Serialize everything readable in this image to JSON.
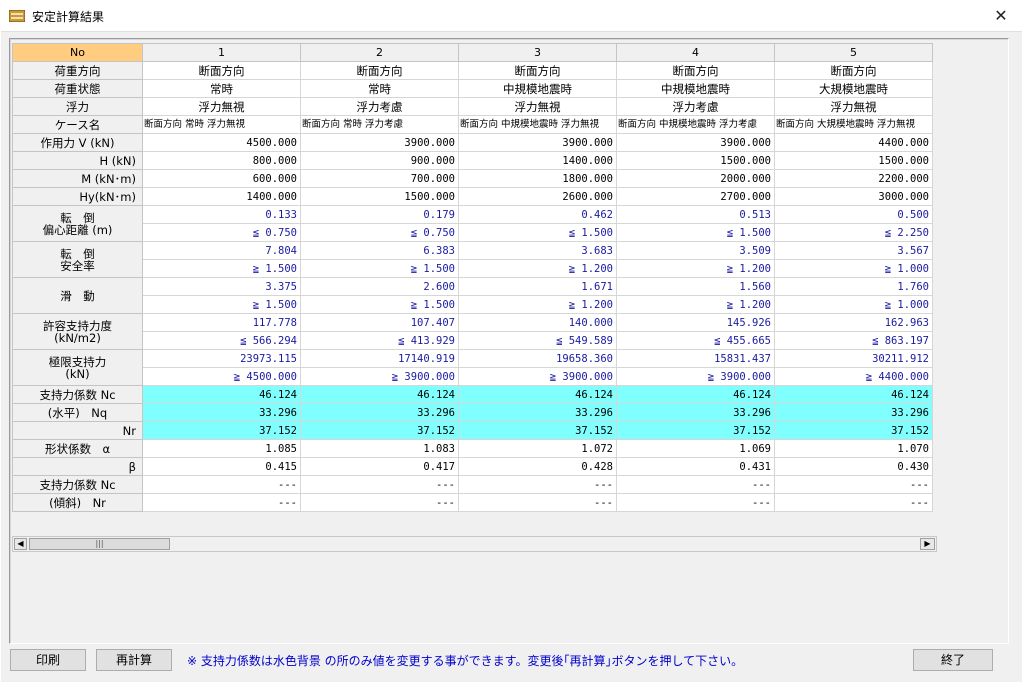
{
  "window": {
    "title": "安定計算結果",
    "close_glyph": "✕",
    "icon": "app-icon"
  },
  "grid": {
    "corner": "No",
    "columns": [
      "1",
      "2",
      "3",
      "4",
      "5"
    ],
    "rows": [
      {
        "label": "荷重方向",
        "style": "txt",
        "values": [
          "断面方向",
          "断面方向",
          "断面方向",
          "断面方向",
          "断面方向"
        ]
      },
      {
        "label": "荷重状態",
        "style": "txt",
        "values": [
          "常時",
          "常時",
          "中規模地震時",
          "中規模地震時",
          "大規模地震時"
        ]
      },
      {
        "label": "浮力",
        "style": "txt",
        "values": [
          "浮力無視",
          "浮力考慮",
          "浮力無視",
          "浮力考慮",
          "浮力無視"
        ]
      },
      {
        "label": "ケース名",
        "style": "case",
        "values": [
          "断面方向 常時 浮力無視",
          "断面方向 常時 浮力考慮",
          "断面方向 中規模地震時 浮力無視",
          "断面方向 中規模地震時 浮力考慮",
          "断面方向 大規模地震時 浮力無視"
        ]
      },
      {
        "label": "作用力 V (kN)",
        "style": "num",
        "values": [
          "4500.000",
          "3900.000",
          "3900.000",
          "3900.000",
          "4400.000"
        ]
      },
      {
        "label": "H (kN)",
        "style": "num",
        "values": [
          "800.000",
          "900.000",
          "1400.000",
          "1500.000",
          "1500.000"
        ]
      },
      {
        "label": "M (kN･m)",
        "style": "num",
        "values": [
          "600.000",
          "700.000",
          "1800.000",
          "2000.000",
          "2200.000"
        ]
      },
      {
        "label": "Hy(kN･m)",
        "style": "num",
        "values": [
          "1400.000",
          "1500.000",
          "2600.000",
          "2700.000",
          "3000.000"
        ]
      },
      {
        "label": "転　倒\n偏心距離 (m)",
        "style": "num blue",
        "values": [
          "0.133",
          "0.179",
          "0.462",
          "0.513",
          "0.500"
        ]
      },
      {
        "label": "",
        "style": "num blue",
        "values": [
          "≦ 0.750",
          "≦ 0.750",
          "≦ 1.500",
          "≦ 1.500",
          "≦ 2.250"
        ]
      },
      {
        "label": "転　倒\n安全率",
        "style": "num blue",
        "values": [
          "7.804",
          "6.383",
          "3.683",
          "3.509",
          "3.567"
        ]
      },
      {
        "label": "",
        "style": "num blue",
        "values": [
          "≧ 1.500",
          "≧ 1.500",
          "≧ 1.200",
          "≧ 1.200",
          "≧ 1.000"
        ]
      },
      {
        "label": "滑　動",
        "style": "num blue",
        "values": [
          "3.375",
          "2.600",
          "1.671",
          "1.560",
          "1.760"
        ]
      },
      {
        "label": "",
        "style": "num blue",
        "values": [
          "≧ 1.500",
          "≧ 1.500",
          "≧ 1.200",
          "≧ 1.200",
          "≧ 1.000"
        ]
      },
      {
        "label": "許容支持力度\n(kN/m2)",
        "style": "num blue",
        "values": [
          "117.778",
          "107.407",
          "140.000",
          "145.926",
          "162.963"
        ]
      },
      {
        "label": "",
        "style": "num blue",
        "values": [
          "≦ 566.294",
          "≦ 413.929",
          "≦ 549.589",
          "≦ 455.665",
          "≦ 863.197"
        ]
      },
      {
        "label": "極限支持力\n(kN)",
        "style": "num blue",
        "values": [
          "23973.115",
          "17140.919",
          "19658.360",
          "15831.437",
          "30211.912"
        ]
      },
      {
        "label": "",
        "style": "num blue",
        "values": [
          "≧ 4500.000",
          "≧ 3900.000",
          "≧ 3900.000",
          "≧ 3900.000",
          "≧ 4400.000"
        ]
      },
      {
        "label": "支持力係数 Nc",
        "style": "num cyan",
        "values": [
          "46.124",
          "46.124",
          "46.124",
          "46.124",
          "46.124"
        ]
      },
      {
        "label": "(水平)　Nq",
        "style": "num cyan",
        "values": [
          "33.296",
          "33.296",
          "33.296",
          "33.296",
          "33.296"
        ]
      },
      {
        "label": "Nr",
        "style": "num cyan",
        "values": [
          "37.152",
          "37.152",
          "37.152",
          "37.152",
          "37.152"
        ]
      },
      {
        "label": "形状係数　α",
        "style": "num",
        "values": [
          "1.085",
          "1.083",
          "1.072",
          "1.069",
          "1.070"
        ]
      },
      {
        "label": "β",
        "style": "num",
        "values": [
          "0.415",
          "0.417",
          "0.428",
          "0.431",
          "0.430"
        ]
      },
      {
        "label": "支持力係数 Nc",
        "style": "num",
        "values": [
          "---",
          "---",
          "---",
          "---",
          "---"
        ]
      },
      {
        "label": "(傾斜)　Nr",
        "style": "num",
        "values": [
          "---",
          "---",
          "---",
          "---",
          "---"
        ]
      }
    ]
  },
  "scrollbar": {
    "left_arrow": "◀",
    "right_arrow": "▶",
    "thumb_grip": "|||"
  },
  "buttons": {
    "print": "印刷",
    "recalc": "再計算",
    "exit": "終了"
  },
  "note": "※ 支持力係数は水色背景 の所のみ値を変更する事ができます。変更後｢再計算｣ボタンを押して下さい。"
}
